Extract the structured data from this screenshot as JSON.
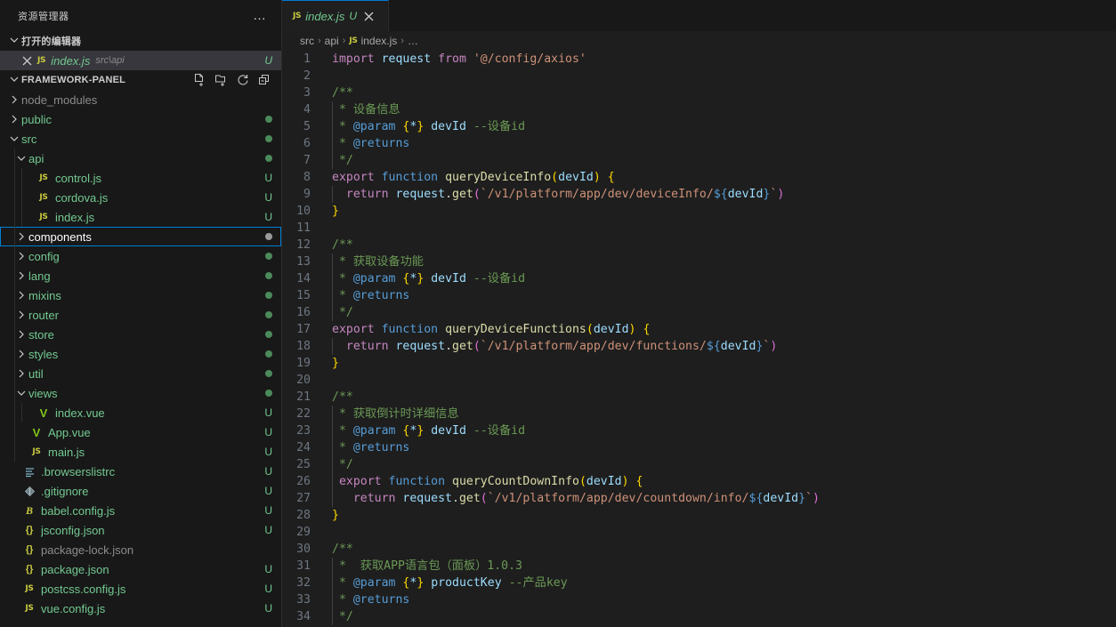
{
  "colors": {
    "accent": "#007FD4",
    "tab_active_border": "#0078D4",
    "sidebar_bg": "#181818",
    "editor_bg": "#1E1E1E",
    "untracked": "#73C991",
    "modified": "#E2C08D"
  },
  "sidebar": {
    "title": "资源管理器",
    "more_actions": "…",
    "open_editors": {
      "label": "打开的编辑器",
      "expanded": true,
      "items": [
        {
          "name": "index.js",
          "description": "src\\api",
          "badge": "U",
          "icon": "js-file-icon",
          "selected": true
        }
      ]
    },
    "project": {
      "label": "FRAMEWORK-PANEL",
      "expanded": true,
      "actions": [
        {
          "name": "new-file-icon",
          "title": "新建文件"
        },
        {
          "name": "new-folder-icon",
          "title": "新建文件夹"
        },
        {
          "name": "refresh-icon",
          "title": "刷新"
        },
        {
          "name": "collapse-all-icon",
          "title": "全部折叠"
        }
      ],
      "tree": [
        {
          "label": "node_modules",
          "type": "folder",
          "expanded": false,
          "depth": 1,
          "badge": "",
          "dot": "",
          "color": "#8C8C8C"
        },
        {
          "label": "public",
          "type": "folder",
          "expanded": false,
          "depth": 1,
          "badge": "",
          "dot": "#4B8A5A",
          "color": "#73C991"
        },
        {
          "label": "src",
          "type": "folder",
          "expanded": true,
          "depth": 1,
          "badge": "",
          "dot": "#4B8A5A",
          "color": "#73C991"
        },
        {
          "label": "api",
          "type": "folder",
          "expanded": true,
          "depth": 2,
          "badge": "",
          "dot": "#4B8A5A",
          "color": "#73C991"
        },
        {
          "label": "control.js",
          "type": "js",
          "depth": 3,
          "badge": "U",
          "dot": "",
          "color": "#73C991"
        },
        {
          "label": "cordova.js",
          "type": "js",
          "depth": 3,
          "badge": "U",
          "dot": "",
          "color": "#73C991"
        },
        {
          "label": "index.js",
          "type": "js",
          "depth": 3,
          "badge": "U",
          "dot": "",
          "color": "#73C991"
        },
        {
          "label": "components",
          "type": "folder",
          "expanded": false,
          "depth": 2,
          "badge": "",
          "dot": "#9A9A9A",
          "color": "#FFFFFF",
          "focused": true
        },
        {
          "label": "config",
          "type": "folder",
          "expanded": false,
          "depth": 2,
          "badge": "",
          "dot": "#4B8A5A",
          "color": "#73C991"
        },
        {
          "label": "lang",
          "type": "folder",
          "expanded": false,
          "depth": 2,
          "badge": "",
          "dot": "#4B8A5A",
          "color": "#73C991"
        },
        {
          "label": "mixins",
          "type": "folder",
          "expanded": false,
          "depth": 2,
          "badge": "",
          "dot": "#4B8A5A",
          "color": "#73C991"
        },
        {
          "label": "router",
          "type": "folder",
          "expanded": false,
          "depth": 2,
          "badge": "",
          "dot": "#4B8A5A",
          "color": "#73C991"
        },
        {
          "label": "store",
          "type": "folder",
          "expanded": false,
          "depth": 2,
          "badge": "",
          "dot": "#4B8A5A",
          "color": "#73C991"
        },
        {
          "label": "styles",
          "type": "folder",
          "expanded": false,
          "depth": 2,
          "badge": "",
          "dot": "#4B8A5A",
          "color": "#73C991"
        },
        {
          "label": "util",
          "type": "folder",
          "expanded": false,
          "depth": 2,
          "badge": "",
          "dot": "#4B8A5A",
          "color": "#73C991"
        },
        {
          "label": "views",
          "type": "folder",
          "expanded": true,
          "depth": 2,
          "badge": "",
          "dot": "#4B8A5A",
          "color": "#73C991"
        },
        {
          "label": "index.vue",
          "type": "vue",
          "depth": 3,
          "badge": "U",
          "dot": "",
          "color": "#73C991"
        },
        {
          "label": "App.vue",
          "type": "vue",
          "depth": 2,
          "badge": "U",
          "dot": "",
          "color": "#73C991"
        },
        {
          "label": "main.js",
          "type": "js",
          "depth": 2,
          "badge": "U",
          "dot": "",
          "color": "#73C991"
        },
        {
          "label": ".browserslistrc",
          "type": "list",
          "depth": 1,
          "badge": "U",
          "dot": "",
          "color": "#73C991"
        },
        {
          "label": ".gitignore",
          "type": "git",
          "depth": 1,
          "badge": "U",
          "dot": "",
          "color": "#73C991"
        },
        {
          "label": "babel.config.js",
          "type": "babel",
          "depth": 1,
          "badge": "U",
          "dot": "",
          "color": "#73C991"
        },
        {
          "label": "jsconfig.json",
          "type": "json",
          "depth": 1,
          "badge": "U",
          "dot": "",
          "color": "#73C991"
        },
        {
          "label": "package-lock.json",
          "type": "json",
          "depth": 1,
          "badge": "",
          "dot": "",
          "color": "#8C8C8C"
        },
        {
          "label": "package.json",
          "type": "json",
          "depth": 1,
          "badge": "U",
          "dot": "",
          "color": "#73C991"
        },
        {
          "label": "postcss.config.js",
          "type": "js",
          "depth": 1,
          "badge": "U",
          "dot": "",
          "color": "#73C991"
        },
        {
          "label": "vue.config.js",
          "type": "js",
          "depth": 1,
          "badge": "U",
          "dot": "",
          "color": "#73C991"
        }
      ]
    }
  },
  "editor": {
    "tabs": [
      {
        "label": "index.js",
        "badge": "U",
        "icon": "js-file-icon",
        "close": "×",
        "active": true
      }
    ],
    "breadcrumb": [
      {
        "label": "src",
        "icon": ""
      },
      {
        "label": "api",
        "icon": ""
      },
      {
        "label": "index.js",
        "icon": "js-file-icon"
      },
      {
        "label": "…",
        "icon": ""
      }
    ],
    "breadcrumb_separator": "›",
    "language": "JavaScript",
    "lines": [
      {
        "n": 1,
        "tokens": [
          {
            "t": "import",
            "c": "t-kw"
          },
          {
            "t": " ",
            "c": "t-plain"
          },
          {
            "t": "request",
            "c": "t-var"
          },
          {
            "t": " ",
            "c": "t-plain"
          },
          {
            "t": "from",
            "c": "t-kw"
          },
          {
            "t": " ",
            "c": "t-plain"
          },
          {
            "t": "'@/config/axios'",
            "c": "t-str"
          }
        ]
      },
      {
        "n": 2,
        "tokens": []
      },
      {
        "n": 3,
        "tokens": [
          {
            "t": "/**",
            "c": "t-cmt"
          }
        ]
      },
      {
        "n": 4,
        "guide": true,
        "tokens": [
          {
            "t": " * 设备信息",
            "c": "t-cmt"
          }
        ]
      },
      {
        "n": 5,
        "guide": true,
        "tokens": [
          {
            "t": " * ",
            "c": "t-cmt"
          },
          {
            "t": "@param",
            "c": "t-doc"
          },
          {
            "t": " ",
            "c": "t-cmt"
          },
          {
            "t": "{",
            "c": "t-brc-y"
          },
          {
            "t": "*",
            "c": "t-type"
          },
          {
            "t": "}",
            "c": "t-brc-y"
          },
          {
            "t": " ",
            "c": "t-cmt"
          },
          {
            "t": "devId",
            "c": "t-var"
          },
          {
            "t": " --设备id",
            "c": "t-cmt"
          }
        ]
      },
      {
        "n": 6,
        "guide": true,
        "tokens": [
          {
            "t": " * ",
            "c": "t-cmt"
          },
          {
            "t": "@returns",
            "c": "t-doc"
          }
        ]
      },
      {
        "n": 7,
        "guide": true,
        "tokens": [
          {
            "t": " */",
            "c": "t-cmt"
          }
        ]
      },
      {
        "n": 8,
        "tokens": [
          {
            "t": "export",
            "c": "t-kw"
          },
          {
            "t": " ",
            "c": "t-plain"
          },
          {
            "t": "function",
            "c": "t-ctl"
          },
          {
            "t": " ",
            "c": "t-plain"
          },
          {
            "t": "queryDeviceInfo",
            "c": "t-fn"
          },
          {
            "t": "(",
            "c": "t-brc-y"
          },
          {
            "t": "devId",
            "c": "t-var"
          },
          {
            "t": ")",
            "c": "t-brc-y"
          },
          {
            "t": " ",
            "c": "t-plain"
          },
          {
            "t": "{",
            "c": "t-brc-y"
          }
        ]
      },
      {
        "n": 9,
        "guide": true,
        "tokens": [
          {
            "t": "  ",
            "c": "t-plain"
          },
          {
            "t": "return",
            "c": "t-kw"
          },
          {
            "t": " ",
            "c": "t-plain"
          },
          {
            "t": "request",
            "c": "t-var"
          },
          {
            "t": ".",
            "c": "t-plain"
          },
          {
            "t": "get",
            "c": "t-prop"
          },
          {
            "t": "(",
            "c": "t-brc-p"
          },
          {
            "t": "`/v1/platform/app/dev/deviceInfo/",
            "c": "t-str"
          },
          {
            "t": "${",
            "c": "t-tpl-d"
          },
          {
            "t": "devId",
            "c": "t-var"
          },
          {
            "t": "}",
            "c": "t-tpl-d"
          },
          {
            "t": "`",
            "c": "t-str"
          },
          {
            "t": ")",
            "c": "t-brc-p"
          }
        ]
      },
      {
        "n": 10,
        "tokens": [
          {
            "t": "}",
            "c": "t-brc-y"
          }
        ]
      },
      {
        "n": 11,
        "tokens": []
      },
      {
        "n": 12,
        "tokens": [
          {
            "t": "/**",
            "c": "t-cmt"
          }
        ]
      },
      {
        "n": 13,
        "guide": true,
        "tokens": [
          {
            "t": " * 获取设备功能",
            "c": "t-cmt"
          }
        ]
      },
      {
        "n": 14,
        "guide": true,
        "tokens": [
          {
            "t": " * ",
            "c": "t-cmt"
          },
          {
            "t": "@param",
            "c": "t-doc"
          },
          {
            "t": " ",
            "c": "t-cmt"
          },
          {
            "t": "{",
            "c": "t-brc-y"
          },
          {
            "t": "*",
            "c": "t-type"
          },
          {
            "t": "}",
            "c": "t-brc-y"
          },
          {
            "t": " ",
            "c": "t-cmt"
          },
          {
            "t": "devId",
            "c": "t-var"
          },
          {
            "t": " --设备id",
            "c": "t-cmt"
          }
        ]
      },
      {
        "n": 15,
        "guide": true,
        "tokens": [
          {
            "t": " * ",
            "c": "t-cmt"
          },
          {
            "t": "@returns",
            "c": "t-doc"
          }
        ]
      },
      {
        "n": 16,
        "guide": true,
        "tokens": [
          {
            "t": " */",
            "c": "t-cmt"
          }
        ]
      },
      {
        "n": 17,
        "tokens": [
          {
            "t": "export",
            "c": "t-kw"
          },
          {
            "t": " ",
            "c": "t-plain"
          },
          {
            "t": "function",
            "c": "t-ctl"
          },
          {
            "t": " ",
            "c": "t-plain"
          },
          {
            "t": "queryDeviceFunctions",
            "c": "t-fn"
          },
          {
            "t": "(",
            "c": "t-brc-y"
          },
          {
            "t": "devId",
            "c": "t-var"
          },
          {
            "t": ")",
            "c": "t-brc-y"
          },
          {
            "t": " ",
            "c": "t-plain"
          },
          {
            "t": "{",
            "c": "t-brc-y"
          }
        ]
      },
      {
        "n": 18,
        "guide": true,
        "tokens": [
          {
            "t": "  ",
            "c": "t-plain"
          },
          {
            "t": "return",
            "c": "t-kw"
          },
          {
            "t": " ",
            "c": "t-plain"
          },
          {
            "t": "request",
            "c": "t-var"
          },
          {
            "t": ".",
            "c": "t-plain"
          },
          {
            "t": "get",
            "c": "t-prop"
          },
          {
            "t": "(",
            "c": "t-brc-p"
          },
          {
            "t": "`/v1/platform/app/dev/functions/",
            "c": "t-str"
          },
          {
            "t": "${",
            "c": "t-tpl-d"
          },
          {
            "t": "devId",
            "c": "t-var"
          },
          {
            "t": "}",
            "c": "t-tpl-d"
          },
          {
            "t": "`",
            "c": "t-str"
          },
          {
            "t": ")",
            "c": "t-brc-p"
          }
        ]
      },
      {
        "n": 19,
        "tokens": [
          {
            "t": "}",
            "c": "t-brc-y"
          }
        ]
      },
      {
        "n": 20,
        "tokens": []
      },
      {
        "n": 21,
        "tokens": [
          {
            "t": "/**",
            "c": "t-cmt"
          }
        ]
      },
      {
        "n": 22,
        "guide": true,
        "tokens": [
          {
            "t": " * 获取倒计时详细信息",
            "c": "t-cmt"
          }
        ]
      },
      {
        "n": 23,
        "guide": true,
        "tokens": [
          {
            "t": " * ",
            "c": "t-cmt"
          },
          {
            "t": "@param",
            "c": "t-doc"
          },
          {
            "t": " ",
            "c": "t-cmt"
          },
          {
            "t": "{",
            "c": "t-brc-y"
          },
          {
            "t": "*",
            "c": "t-type"
          },
          {
            "t": "}",
            "c": "t-brc-y"
          },
          {
            "t": " ",
            "c": "t-cmt"
          },
          {
            "t": "devId",
            "c": "t-var"
          },
          {
            "t": " --设备id",
            "c": "t-cmt"
          }
        ]
      },
      {
        "n": 24,
        "guide": true,
        "tokens": [
          {
            "t": " * ",
            "c": "t-cmt"
          },
          {
            "t": "@returns",
            "c": "t-doc"
          }
        ]
      },
      {
        "n": 25,
        "guide": true,
        "tokens": [
          {
            "t": " */",
            "c": "t-cmt"
          }
        ]
      },
      {
        "n": 26,
        "guide": true,
        "tokens": [
          {
            "t": " ",
            "c": "t-plain"
          },
          {
            "t": "export",
            "c": "t-kw"
          },
          {
            "t": " ",
            "c": "t-plain"
          },
          {
            "t": "function",
            "c": "t-ctl"
          },
          {
            "t": " ",
            "c": "t-plain"
          },
          {
            "t": "queryCountDownInfo",
            "c": "t-fn"
          },
          {
            "t": "(",
            "c": "t-brc-y"
          },
          {
            "t": "devId",
            "c": "t-var"
          },
          {
            "t": ")",
            "c": "t-brc-y"
          },
          {
            "t": " ",
            "c": "t-plain"
          },
          {
            "t": "{",
            "c": "t-brc-y"
          }
        ]
      },
      {
        "n": 27,
        "guide": true,
        "tokens": [
          {
            "t": "   ",
            "c": "t-plain"
          },
          {
            "t": "return",
            "c": "t-kw"
          },
          {
            "t": " ",
            "c": "t-plain"
          },
          {
            "t": "request",
            "c": "t-var"
          },
          {
            "t": ".",
            "c": "t-plain"
          },
          {
            "t": "get",
            "c": "t-prop"
          },
          {
            "t": "(",
            "c": "t-brc-p"
          },
          {
            "t": "`/v1/platform/app/dev/countdown/info/",
            "c": "t-str"
          },
          {
            "t": "${",
            "c": "t-tpl-d"
          },
          {
            "t": "devId",
            "c": "t-var"
          },
          {
            "t": "}",
            "c": "t-tpl-d"
          },
          {
            "t": "`",
            "c": "t-str"
          },
          {
            "t": ")",
            "c": "t-brc-p"
          }
        ]
      },
      {
        "n": 28,
        "tokens": [
          {
            "t": "}",
            "c": "t-brc-y"
          }
        ]
      },
      {
        "n": 29,
        "tokens": []
      },
      {
        "n": 30,
        "tokens": [
          {
            "t": "/**",
            "c": "t-cmt"
          }
        ]
      },
      {
        "n": 31,
        "guide": true,
        "tokens": [
          {
            "t": " *  获取APP语言包（面板）1.0.3",
            "c": "t-cmt"
          }
        ]
      },
      {
        "n": 32,
        "guide": true,
        "tokens": [
          {
            "t": " * ",
            "c": "t-cmt"
          },
          {
            "t": "@param",
            "c": "t-doc"
          },
          {
            "t": " ",
            "c": "t-cmt"
          },
          {
            "t": "{",
            "c": "t-brc-y"
          },
          {
            "t": "*",
            "c": "t-type"
          },
          {
            "t": "}",
            "c": "t-brc-y"
          },
          {
            "t": " ",
            "c": "t-cmt"
          },
          {
            "t": "productKey",
            "c": "t-var"
          },
          {
            "t": " --产品key",
            "c": "t-cmt"
          }
        ]
      },
      {
        "n": 33,
        "guide": true,
        "tokens": [
          {
            "t": " * ",
            "c": "t-cmt"
          },
          {
            "t": "@returns",
            "c": "t-doc"
          }
        ]
      },
      {
        "n": 34,
        "guide": true,
        "tokens": [
          {
            "t": " */",
            "c": "t-cmt"
          }
        ]
      }
    ]
  }
}
